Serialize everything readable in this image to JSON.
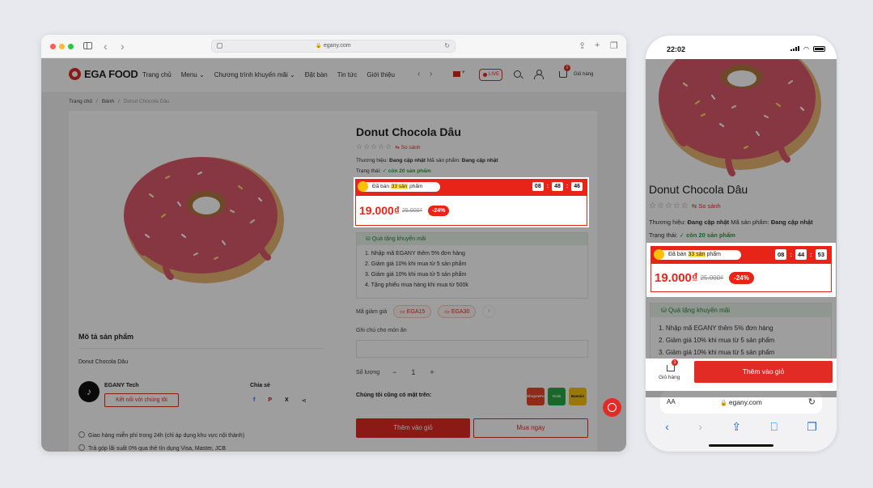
{
  "colors": {
    "brand_red": "#e12b24",
    "flash_red": "#e82418",
    "success_green": "#2a9d3a"
  },
  "desktop": {
    "url": "egany.com",
    "logo_text": "EGA FOOD",
    "menu": [
      "Trang chủ",
      "Menu",
      "Chương trình khuyến mãi",
      "Đặt bàn",
      "Tin tức",
      "Giới thiệu"
    ],
    "live_label": "LIVE",
    "cart_badge": "0",
    "cart_label": "Giỏ hàng",
    "breadcrumb": [
      "Trang chủ",
      "Bánh",
      "Donut Chocola Dâu"
    ],
    "product": {
      "title": "Donut Chocola Dâu",
      "compare_label": "So sánh",
      "brand_label": "Thương hiệu:",
      "brand_value": "Đang cập nhật",
      "sku_label": "Mã sản phẩm:",
      "sku_value": "Đang cập nhật",
      "status_label": "Trạng thái:",
      "status_value": "còn 20 sản phẩm"
    },
    "flash": {
      "sold_pre": "Đã bán ",
      "sold_hl": "33 sản",
      "sold_post": " phẩm",
      "timer": [
        "08",
        "48",
        "46"
      ],
      "price": "19.000₫",
      "old_price": "25.000₫",
      "discount": "-24%"
    },
    "promo": {
      "title": "Quà tặng khuyến mãi",
      "items": [
        "1. Nhập mã EGANY thêm 5% đơn hàng",
        "2. Giảm giá 10% khi mua từ 5 sản phẩm",
        "3. Giảm giá 10% khi mua từ 5 sản phẩm",
        "4. Tặng phiếu mua hàng khi mua từ 500k"
      ]
    },
    "coupon_label": "Mã giảm giá",
    "coupons": [
      "EGA15",
      "EGA30"
    ],
    "note_label": "Ghi chú cho món ăn",
    "qty_label": "Số lượng",
    "qty_minus": "−",
    "qty_value": "1",
    "qty_plus": "+",
    "also_on_label": "Chúng tôi cũng có mặt trên:",
    "apps": [
      "ShopeeFood",
      "Grab Food",
      "Baemin"
    ],
    "add_to_cart": "Thêm vào giỏ",
    "buy_now": "Mua ngay",
    "description_title": "Mô tả sản phẩm",
    "description_text": "Donut Chocola Dâu",
    "brand_name": "EGANY Tech",
    "brand_connect": "Kết nối với chúng tôi",
    "share_label": "Chia sẻ",
    "share_icons": [
      "facebook-icon",
      "pinterest-icon",
      "x-icon",
      "share-icon"
    ],
    "perks": [
      "Giao hàng miễn phí trong 24h (chỉ áp dụng khu vực nội thành)",
      "Trả góp lãi suất 0% qua thẻ tín dụng Visa, Master, JCB"
    ]
  },
  "mobile": {
    "time": "22:02",
    "product_title": "Donut Chocola Dâu",
    "compare_label": "So sánh",
    "brand_label": "Thương hiệu:",
    "brand_value": "Đang cập nhật",
    "sku_label": "Mã sản phẩm:",
    "sku_value": "Đang cập nhật",
    "status_label": "Trạng thái:",
    "status_value": "còn 20 sản phẩm",
    "flash": {
      "sold_pre": "Đã bán ",
      "sold_hl": "33 sản",
      "sold_post": " phẩm",
      "timer": [
        "08",
        "44",
        "53"
      ],
      "price": "19.000₫",
      "old_price": "25.000₫",
      "discount": "-24%"
    },
    "promo_title": "Quà tặng khuyến mãi",
    "promo_items": [
      "1. Nhập mã EGANY thêm 5% đơn hàng",
      "2. Giảm giá 10% khi mua từ 5 sản phẩm",
      "3. Giảm giá 10% khi mua từ 5 sản phẩm"
    ],
    "cart_badge": "1",
    "cart_label": "Giỏ hàng",
    "add_to_cart": "Thêm vào giỏ",
    "text_size": "AA",
    "url": "egany.com"
  }
}
